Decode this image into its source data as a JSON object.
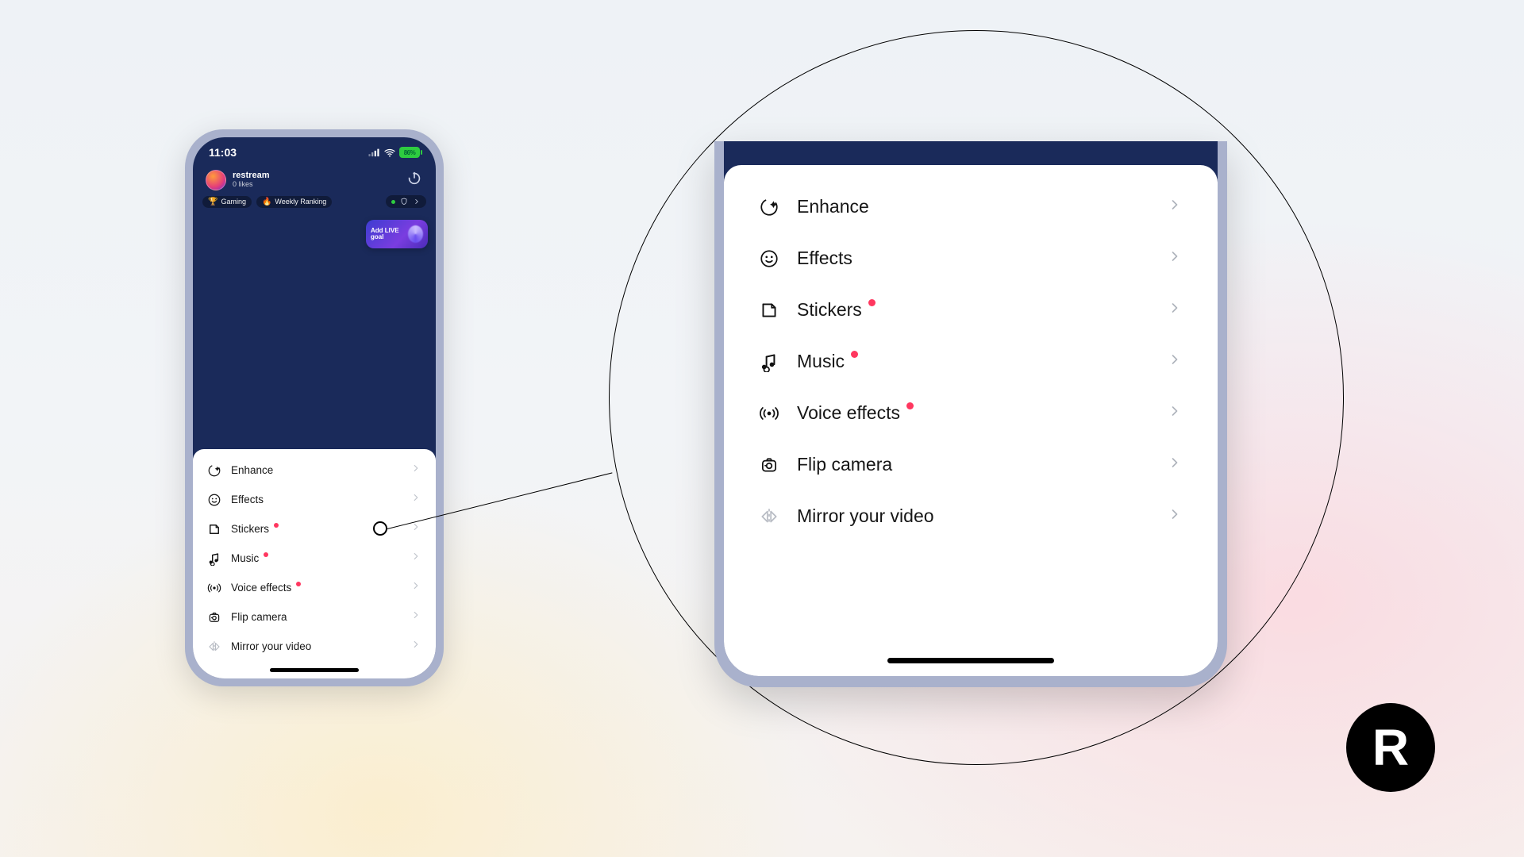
{
  "status": {
    "time": "11:03",
    "battery": "86%"
  },
  "header": {
    "username": "restream",
    "likes": "0 likes",
    "chip1": "Gaming",
    "chip2": "Weekly Ranking",
    "goal": "Add LIVE goal"
  },
  "menu": {
    "items": [
      {
        "id": "enhance",
        "label": "Enhance",
        "icon": "enhance-icon",
        "dot": false,
        "muted": false
      },
      {
        "id": "effects",
        "label": "Effects",
        "icon": "smiley-icon",
        "dot": false,
        "muted": false
      },
      {
        "id": "stickers",
        "label": "Stickers",
        "icon": "sticker-icon",
        "dot": true,
        "muted": false
      },
      {
        "id": "music",
        "label": "Music",
        "icon": "music-note-icon",
        "dot": true,
        "muted": false
      },
      {
        "id": "voice",
        "label": "Voice effects",
        "icon": "soundwave-icon",
        "dot": true,
        "muted": false
      },
      {
        "id": "flip",
        "label": "Flip camera",
        "icon": "flip-camera-icon",
        "dot": false,
        "muted": false
      },
      {
        "id": "mirror",
        "label": "Mirror your video",
        "icon": "mirror-icon",
        "dot": false,
        "muted": true
      }
    ]
  },
  "brand": {
    "letter": "R"
  }
}
